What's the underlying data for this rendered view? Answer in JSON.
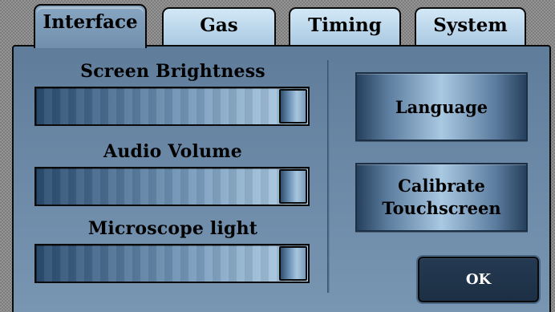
{
  "tabs": [
    {
      "label": "Interface",
      "active": true
    },
    {
      "label": "Gas",
      "active": false
    },
    {
      "label": "Timing",
      "active": false
    },
    {
      "label": "System",
      "active": false
    }
  ],
  "sliders": [
    {
      "label": "Screen Brightness",
      "level": 1.0
    },
    {
      "label": "Audio Volume",
      "level": 1.0
    },
    {
      "label": "Microscope light",
      "level": 1.0
    }
  ],
  "buttons": {
    "language": "Language",
    "calibrate_line1": "Calibrate",
    "calibrate_line2": "Touchscreen",
    "ok": "OK"
  },
  "colors": {
    "panel": "#6b89a6",
    "tab_active": "#7f9dba",
    "tab_inactive": "#c4ddf0",
    "ok_button": "#1c2f44"
  }
}
